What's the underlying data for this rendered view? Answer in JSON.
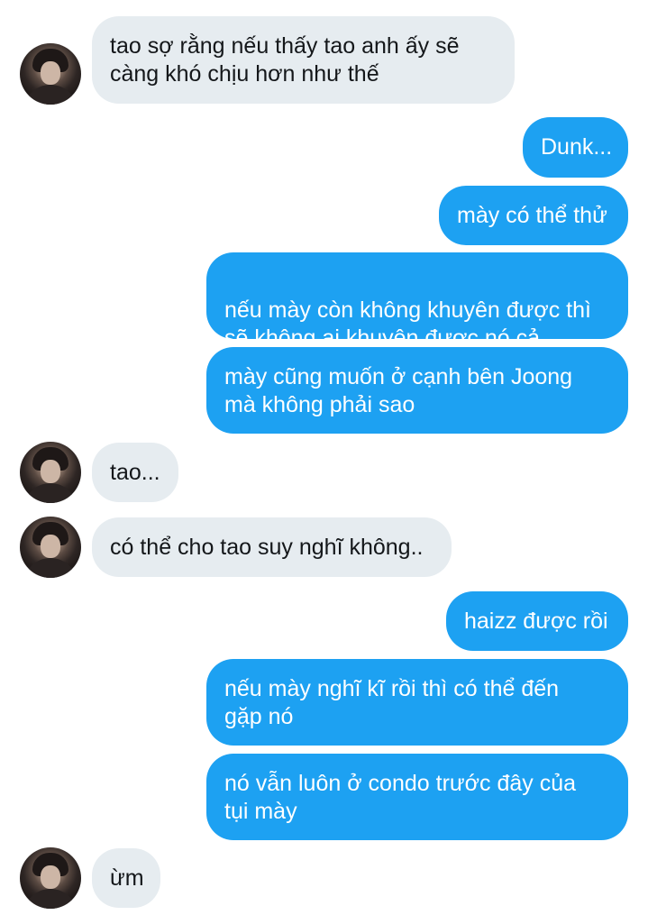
{
  "conversation": {
    "messages": [
      {
        "side": "in",
        "text": "tao sợ rằng nếu thấy tao anh ấy sẽ\ncàng khó chịu hơn như thế",
        "avatar": "contact-avatar"
      },
      {
        "side": "out",
        "text": "Dunk..."
      },
      {
        "side": "out",
        "text": "mày có thể thử"
      },
      {
        "side": "out",
        "text": "nếu mày còn không khuyên được thì\nsẽ không ai khuyên được nó cả"
      },
      {
        "side": "out",
        "text": "mày cũng muốn ở cạnh bên Joong\nmà không phải sao"
      },
      {
        "side": "in",
        "text": "tao...",
        "avatar": "contact-avatar"
      },
      {
        "side": "in",
        "text": "có thể cho tao suy nghĩ không..",
        "avatar": "contact-avatar"
      },
      {
        "side": "out",
        "text": "haizz được rồi"
      },
      {
        "side": "out",
        "text": "nếu mày nghĩ kĩ rồi thì có thể đến\ngặp nó"
      },
      {
        "side": "out",
        "text": "nó vẫn luôn ở condo trước đây của\ntụi mày"
      },
      {
        "side": "in",
        "text": "ừm",
        "avatar": "contact-avatar"
      }
    ]
  },
  "colors": {
    "incoming_bubble": "#e6ecf0",
    "incoming_text": "#14171a",
    "outgoing_bubble": "#1da1f2",
    "outgoing_text": "#ffffff"
  }
}
